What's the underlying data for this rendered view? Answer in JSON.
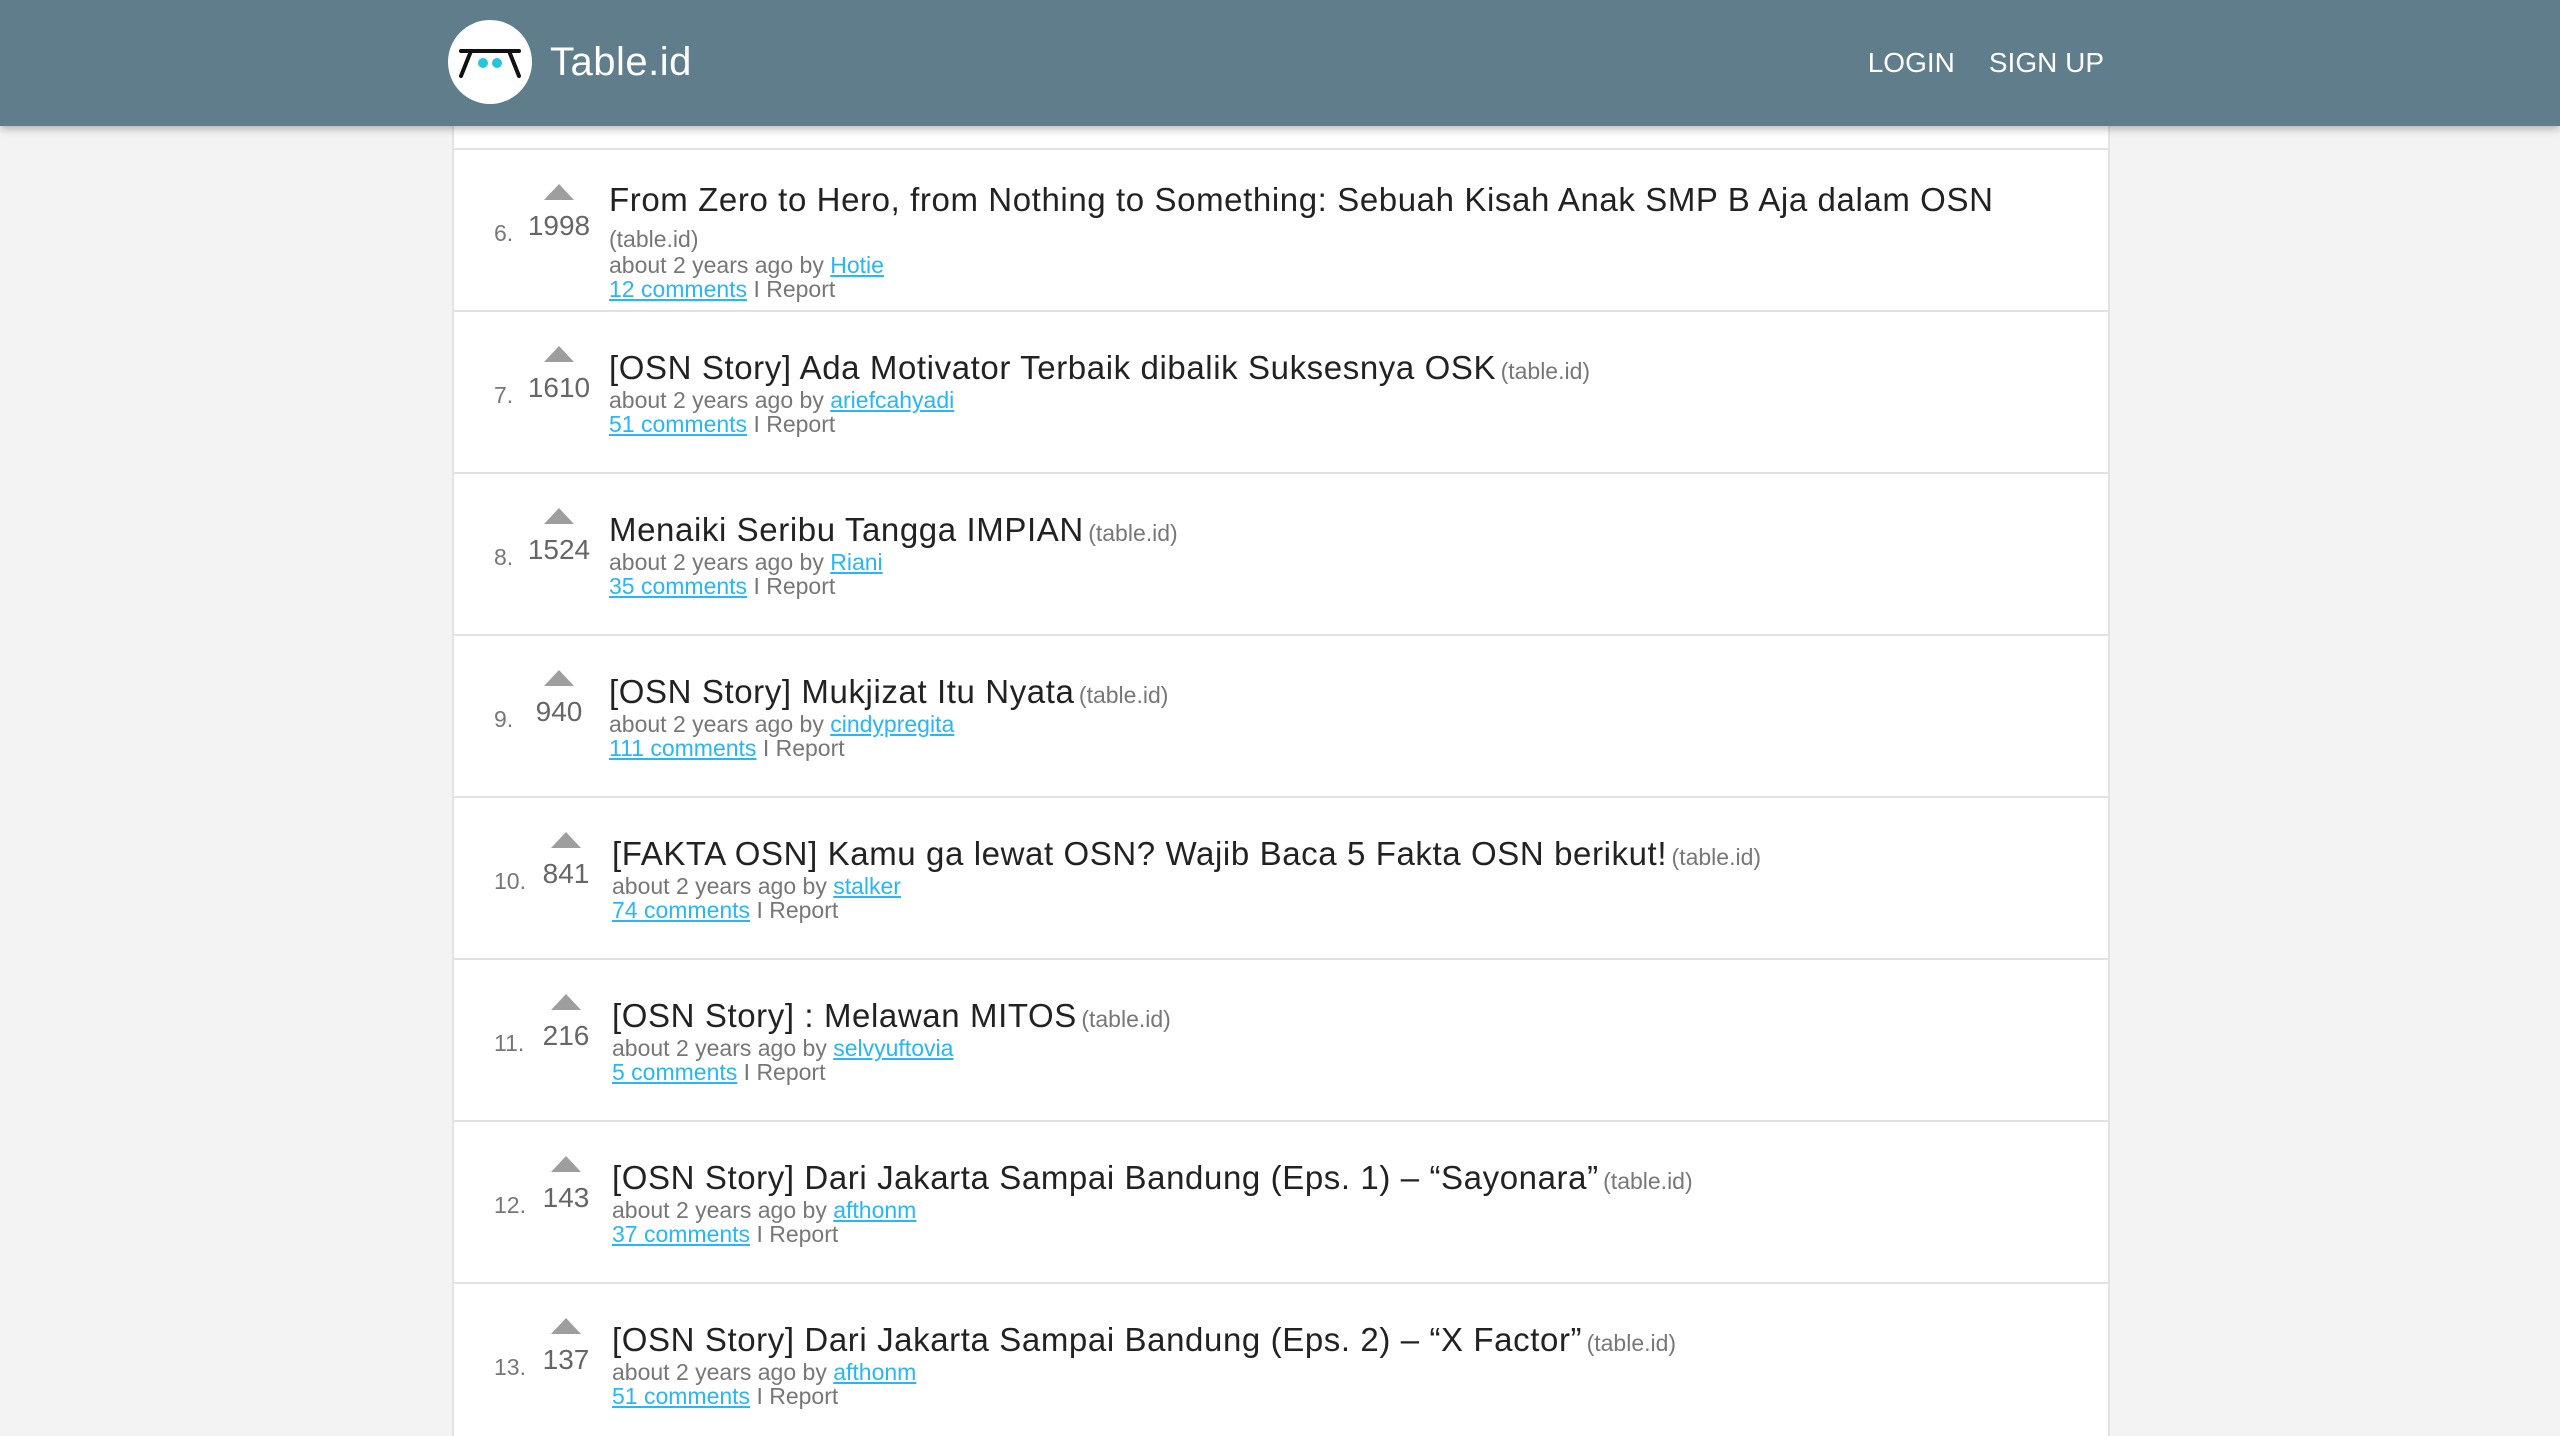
{
  "header": {
    "brand": "Table.id",
    "nav": [
      {
        "label": "LOGIN"
      },
      {
        "label": "SIGN UP"
      }
    ]
  },
  "colors": {
    "header_bg": "#607d8b",
    "link": "#29b6f6",
    "arrow": "#9e9e9e"
  },
  "posts": [
    {
      "rank": "6.",
      "score": "1998",
      "title": "From Zero to Hero, from Nothing to Something: Sebuah Kisah Anak SMP B Aja dalam OSN",
      "domain": "(table.id)",
      "meta_prefix": "about 2 years ago by",
      "author": "Hotie",
      "comments": "12 comments",
      "divider": "I",
      "report": "Report"
    },
    {
      "rank": "7.",
      "score": "1610",
      "title": "[OSN Story] Ada Motivator Terbaik dibalik Suksesnya OSK",
      "domain": "(table.id)",
      "meta_prefix": "about 2 years ago by",
      "author": "ariefcahyadi",
      "comments": "51 comments",
      "divider": "I",
      "report": "Report"
    },
    {
      "rank": "8.",
      "score": "1524",
      "title": "Menaiki Seribu Tangga IMPIAN",
      "domain": "(table.id)",
      "meta_prefix": "about 2 years ago by",
      "author": "Riani",
      "comments": "35 comments",
      "divider": "I",
      "report": "Report"
    },
    {
      "rank": "9.",
      "score": "940",
      "title": "[OSN Story] Mukjizat Itu Nyata",
      "domain": "(table.id)",
      "meta_prefix": "about 2 years ago by",
      "author": "cindypregita",
      "comments": "111 comments",
      "divider": "I",
      "report": "Report"
    },
    {
      "rank": "10.",
      "score": "841",
      "title": "[FAKTA OSN] Kamu ga lewat OSN? Wajib Baca 5 Fakta OSN berikut!",
      "domain": "(table.id)",
      "meta_prefix": "about 2 years ago by",
      "author": "stalker",
      "comments": "74 comments",
      "divider": "I",
      "report": "Report"
    },
    {
      "rank": "11.",
      "score": "216",
      "title": "[OSN Story] : Melawan MITOS",
      "domain": "(table.id)",
      "meta_prefix": "about 2 years ago by",
      "author": "selvyuftovia",
      "comments": "5 comments",
      "divider": "I",
      "report": "Report"
    },
    {
      "rank": "12.",
      "score": "143",
      "title": "[OSN Story] Dari Jakarta Sampai Bandung (Eps. 1) – “Sayonara”",
      "domain": "(table.id)",
      "meta_prefix": "about 2 years ago by",
      "author": "afthonm",
      "comments": "37 comments",
      "divider": "I",
      "report": "Report"
    },
    {
      "rank": "13.",
      "score": "137",
      "title": "[OSN Story] Dari Jakarta Sampai Bandung (Eps. 2) – “X Factor”",
      "domain": "(table.id)",
      "meta_prefix": "about 2 years ago by",
      "author": "afthonm",
      "comments": "51 comments",
      "divider": "I",
      "report": "Report"
    }
  ]
}
